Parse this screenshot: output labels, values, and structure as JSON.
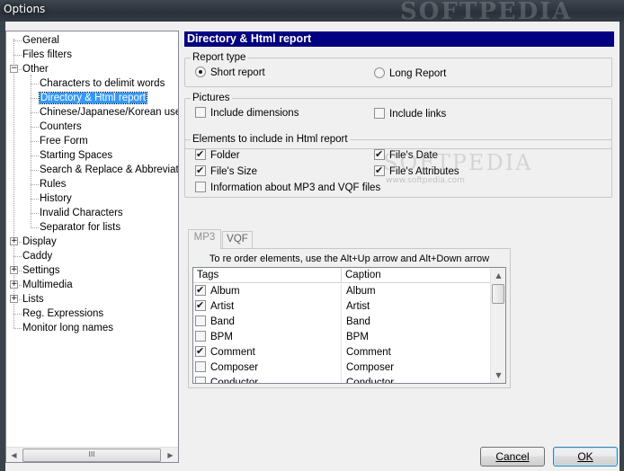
{
  "window": {
    "title": "Options",
    "watermark": "SOFTPEDIA"
  },
  "tree": {
    "items": [
      {
        "label": "General",
        "level": 0,
        "expander": ""
      },
      {
        "label": "Files filters",
        "level": 0,
        "expander": ""
      },
      {
        "label": "Other",
        "level": 0,
        "expander": "−"
      },
      {
        "label": "Characters to delimit words",
        "level": 1,
        "expander": ""
      },
      {
        "label": "Directory & Html report",
        "level": 1,
        "expander": "",
        "selected": true
      },
      {
        "label": "Chinese/Japanese/Korean users",
        "level": 1,
        "expander": ""
      },
      {
        "label": "Counters",
        "level": 1,
        "expander": ""
      },
      {
        "label": "Free Form",
        "level": 1,
        "expander": ""
      },
      {
        "label": "Starting Spaces",
        "level": 1,
        "expander": ""
      },
      {
        "label": "Search & Replace & Abbreviations",
        "level": 1,
        "expander": ""
      },
      {
        "label": "Rules",
        "level": 1,
        "expander": ""
      },
      {
        "label": "History",
        "level": 1,
        "expander": ""
      },
      {
        "label": "Invalid Characters",
        "level": 1,
        "expander": ""
      },
      {
        "label": "Separator for lists",
        "level": 1,
        "expander": ""
      },
      {
        "label": "Display",
        "level": 0,
        "expander": "+"
      },
      {
        "label": "Caddy",
        "level": 0,
        "expander": ""
      },
      {
        "label": "Settings",
        "level": 0,
        "expander": "+"
      },
      {
        "label": "Multimedia",
        "level": 0,
        "expander": "+"
      },
      {
        "label": "Lists",
        "level": 0,
        "expander": "+"
      },
      {
        "label": "Reg. Expressions",
        "level": 0,
        "expander": ""
      },
      {
        "label": "Monitor long names",
        "level": 0,
        "expander": ""
      }
    ],
    "scroll_thumb_glyph": "III"
  },
  "panel": {
    "header": "Directory & Html report",
    "report_type": {
      "label": "Report type",
      "short": "Short report",
      "long": "Long Report",
      "selected": "short"
    },
    "pictures": {
      "label": "Pictures",
      "include_dimensions": "Include dimensions",
      "include_links": "Include links",
      "dimensions_checked": false,
      "links_checked": false
    },
    "elements": {
      "label": "Elements to include in Html report",
      "folder": "Folder",
      "files_date": "File's Date",
      "files_size": "File's Size",
      "files_attributes": "File's Attributes",
      "mp3_info": "Information about MP3 and VQF files"
    },
    "tabs": [
      "MP3",
      "VQF"
    ],
    "hint": "To re order elements, use the Alt+Up arrow and Alt+Down arrow",
    "grid": {
      "columns": [
        "Tags",
        "Caption"
      ],
      "rows": [
        {
          "tag": "Album",
          "caption": "Album",
          "checked": true
        },
        {
          "tag": "Artist",
          "caption": "Artist",
          "checked": true
        },
        {
          "tag": "Band",
          "caption": "Band",
          "checked": false
        },
        {
          "tag": "BPM",
          "caption": "BPM",
          "checked": false
        },
        {
          "tag": "Comment",
          "caption": "Comment",
          "checked": true
        },
        {
          "tag": "Composer",
          "caption": "Composer",
          "checked": false
        },
        {
          "tag": "Conductor",
          "caption": "Conductor",
          "checked": false
        }
      ]
    }
  },
  "buttons": {
    "cancel": "Cancel",
    "ok": "OK"
  },
  "mid_watermark": {
    "brand": "SOFTPEDIA",
    "url": "www.softpedia.com"
  }
}
